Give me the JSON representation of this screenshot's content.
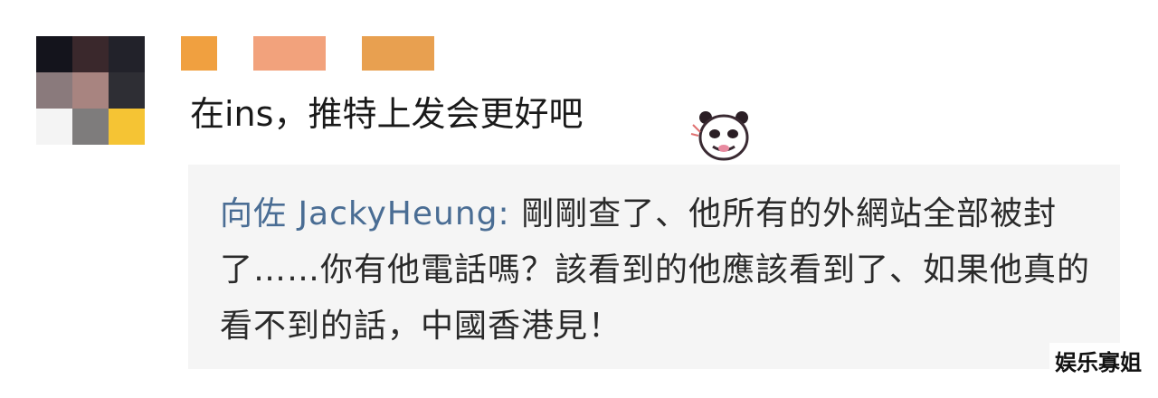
{
  "comment": {
    "avatar_icon": "blurred-user-avatar",
    "text": "在ins，推特上发会更好吧",
    "sticker_icon": "panda-sticker-icon"
  },
  "reply": {
    "author": "向佐 JackyHeung:",
    "text": " 剛剛查了、他所有的外網站全部被封了……你有他電話嗎？該看到的他應該看到了、如果他真的看不到的話，中國香港見！"
  },
  "watermark": "娱乐寡姐",
  "colors": {
    "reply_author": "#4a6d94",
    "reply_background": "#f5f5f5",
    "text": "#1a1a1a"
  }
}
